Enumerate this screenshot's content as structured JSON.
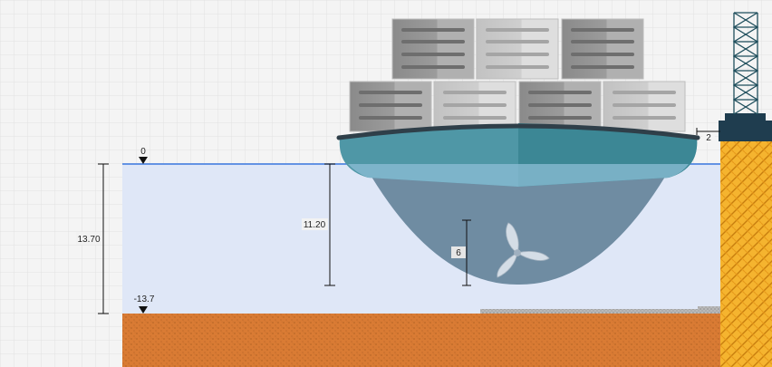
{
  "labels": {
    "water_level": "0",
    "bed_level": "-13.7",
    "water_depth": "13.70",
    "ship_draught": "11.20",
    "propeller_diameter": "6",
    "quay_offset": "2"
  },
  "colors": {
    "water": "#dfe7f7",
    "water_line": "#3a78e0",
    "seabed": "#d97b34",
    "quay_fill": "#f5b42f",
    "quay_cap": "#1f3d4f",
    "hull_top": "#4f97a6",
    "hull_bottom": "#6f8ca2",
    "container_dark": "#8e8e8e",
    "container_light": "#c9c9c9"
  },
  "icons": {
    "propeller": "propeller-icon",
    "level_marker": "triangle-down-icon"
  }
}
